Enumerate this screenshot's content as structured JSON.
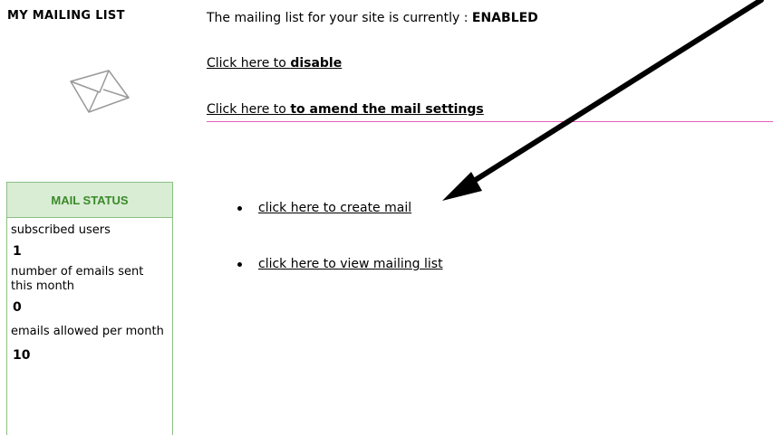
{
  "sidebar": {
    "title": "MY MAILING LIST",
    "envelope_icon": "envelope-icon"
  },
  "status": {
    "prefix": "The mailing list for your site is currently : ",
    "state": "ENABLED"
  },
  "actions": {
    "disable": {
      "prefix": "Click here to ",
      "emphasis": "disable"
    },
    "amend": {
      "prefix": "Click here to ",
      "emphasis": "to amend the mail settings"
    }
  },
  "mail_status": {
    "header": "MAIL STATUS",
    "rows": [
      {
        "label": "subscribed users",
        "value": "1"
      },
      {
        "label": "number of emails sent this month",
        "value": "0"
      },
      {
        "label": "emails allowed per month",
        "value": "10"
      }
    ]
  },
  "links": [
    {
      "label": "click here to create mail"
    },
    {
      "label": "click here to view mailing list"
    }
  ],
  "colors": {
    "divider": "#e060b8",
    "panel_border": "#8cbf84",
    "panel_header_bg": "#d9ecd4",
    "panel_header_text": "#3a8a2a"
  }
}
